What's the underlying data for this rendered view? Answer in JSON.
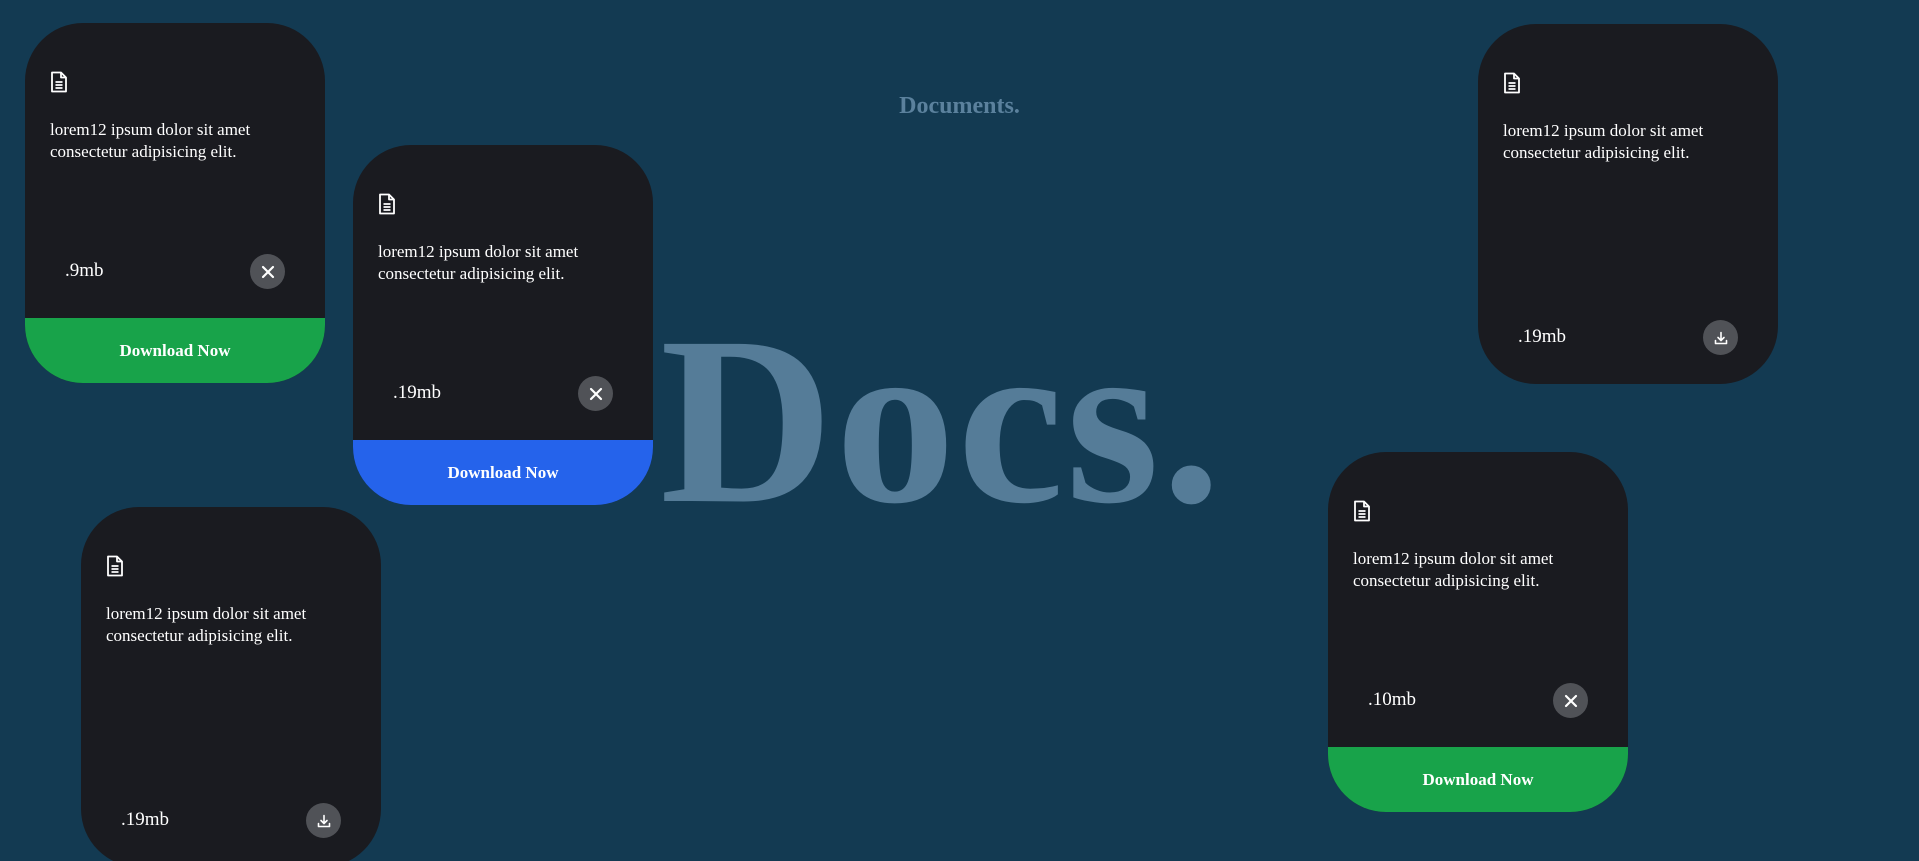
{
  "header": {
    "subtitle": "Documents.",
    "hero_title": "Docs."
  },
  "cards": [
    {
      "description": "lorem12 ipsum dolor sit amet consectetur adipisicing elit.",
      "size": ".9mb",
      "action_icon": "close-icon",
      "download_label": "Download Now",
      "download_color": "#18a34a"
    },
    {
      "description": "lorem12 ipsum dolor sit amet consectetur adipisicing elit.",
      "size": ".19mb",
      "action_icon": "close-icon",
      "download_label": "Download Now",
      "download_color": "#2563eb"
    },
    {
      "description": "lorem12 ipsum dolor sit amet consectetur adipisicing elit.",
      "size": ".19mb",
      "action_icon": "download-icon"
    },
    {
      "description": "lorem12 ipsum dolor sit amet consectetur adipisicing elit.",
      "size": ".10mb",
      "action_icon": "close-icon",
      "download_label": "Download Now",
      "download_color": "#18a34a"
    },
    {
      "description": "lorem12 ipsum dolor sit amet consectetur adipisicing elit.",
      "size": ".19mb",
      "action_icon": "download-icon"
    }
  ],
  "colors": {
    "background": "#133a52",
    "card": "#1a1b20",
    "hero_text": "#557c98",
    "green_button": "#18a34a",
    "blue_button": "#2563eb"
  }
}
